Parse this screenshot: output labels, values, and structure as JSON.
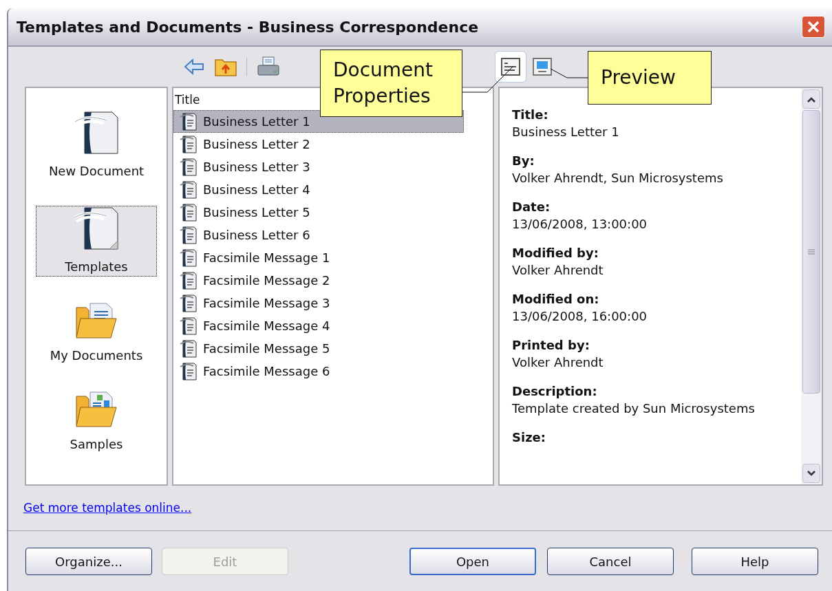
{
  "window": {
    "title": "Templates and Documents - Business Correspondence"
  },
  "view_buttons": [
    {
      "kind": "properties",
      "selected": true
    },
    {
      "kind": "preview",
      "selected": false
    }
  ],
  "callouts": [
    {
      "kind": "properties",
      "text": "Document Properties"
    },
    {
      "kind": "preview",
      "text": "Preview"
    }
  ],
  "sidebar": {
    "items": [
      {
        "kind": "new",
        "label": "New Document",
        "selected": false
      },
      {
        "kind": "templates",
        "label": "Templates",
        "selected": true
      },
      {
        "kind": "mydocs",
        "label": "My Documents",
        "selected": false
      },
      {
        "kind": "samples",
        "label": "Samples",
        "selected": false
      }
    ]
  },
  "list": {
    "column": "Title",
    "rows": [
      {
        "title": "Business Letter 1",
        "selected": true
      },
      {
        "title": "Business Letter 2",
        "selected": false
      },
      {
        "title": "Business Letter 3",
        "selected": false
      },
      {
        "title": "Business Letter 4",
        "selected": false
      },
      {
        "title": "Business Letter 5",
        "selected": false
      },
      {
        "title": "Business Letter 6",
        "selected": false
      },
      {
        "title": "Facsimile Message 1",
        "selected": false
      },
      {
        "title": "Facsimile Message 2",
        "selected": false
      },
      {
        "title": "Facsimile Message 3",
        "selected": false
      },
      {
        "title": "Facsimile Message 4",
        "selected": false
      },
      {
        "title": "Facsimile Message 5",
        "selected": false
      },
      {
        "title": "Facsimile Message 6",
        "selected": false
      }
    ]
  },
  "properties": [
    {
      "label": "Title:",
      "value": "Business Letter 1"
    },
    {
      "label": "By:",
      "value": "Volker Ahrendt, Sun Microsystems"
    },
    {
      "label": "Date:",
      "value": "13/06/2008, 13:00:00"
    },
    {
      "label": "Modified by:",
      "value": "Volker Ahrendt"
    },
    {
      "label": "Modified on:",
      "value": "13/06/2008, 16:00:00"
    },
    {
      "label": "Printed by:",
      "value": "Volker Ahrendt"
    },
    {
      "label": "Description:",
      "value": "Template created by Sun Microsystems"
    },
    {
      "label": "Size:"
    }
  ],
  "link": "Get more templates online...",
  "buttons": [
    {
      "label": "Organize...",
      "disabled": false,
      "default": false
    },
    {
      "label": "Edit",
      "disabled": true,
      "default": false
    },
    {
      "label": "Open",
      "disabled": false,
      "default": true
    },
    {
      "label": "Cancel",
      "disabled": false,
      "default": false
    },
    {
      "label": "Help",
      "disabled": false,
      "default": false
    }
  ]
}
